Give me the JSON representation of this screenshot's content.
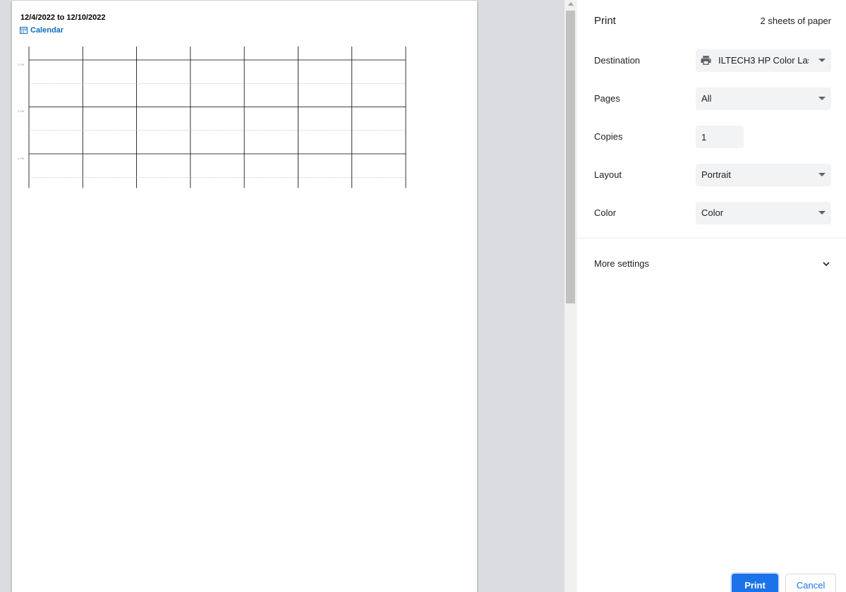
{
  "preview": {
    "date_range": "12/4/2022 to 12/10/2022",
    "calendar_label": "Calendar",
    "time_labels": [
      "2 PM",
      "3 PM",
      "4 PM"
    ],
    "day_columns": 7,
    "calendar_icon": "calendar-icon"
  },
  "settings": {
    "title": "Print",
    "sheets": "2 sheets of paper",
    "destination": {
      "label": "Destination",
      "value": "ILTECH3 HP Color Las",
      "icon": "printer-icon"
    },
    "pages": {
      "label": "Pages",
      "value": "All"
    },
    "copies": {
      "label": "Copies",
      "value": "1"
    },
    "layout": {
      "label": "Layout",
      "value": "Portrait"
    },
    "color": {
      "label": "Color",
      "value": "Color"
    },
    "more_settings": "More settings",
    "print_label": "Print",
    "cancel_label": "Cancel"
  },
  "colors": {
    "accent": "#1a73e8",
    "calendar_link": "#0f6cbd",
    "field_background": "#f1f3f4"
  }
}
